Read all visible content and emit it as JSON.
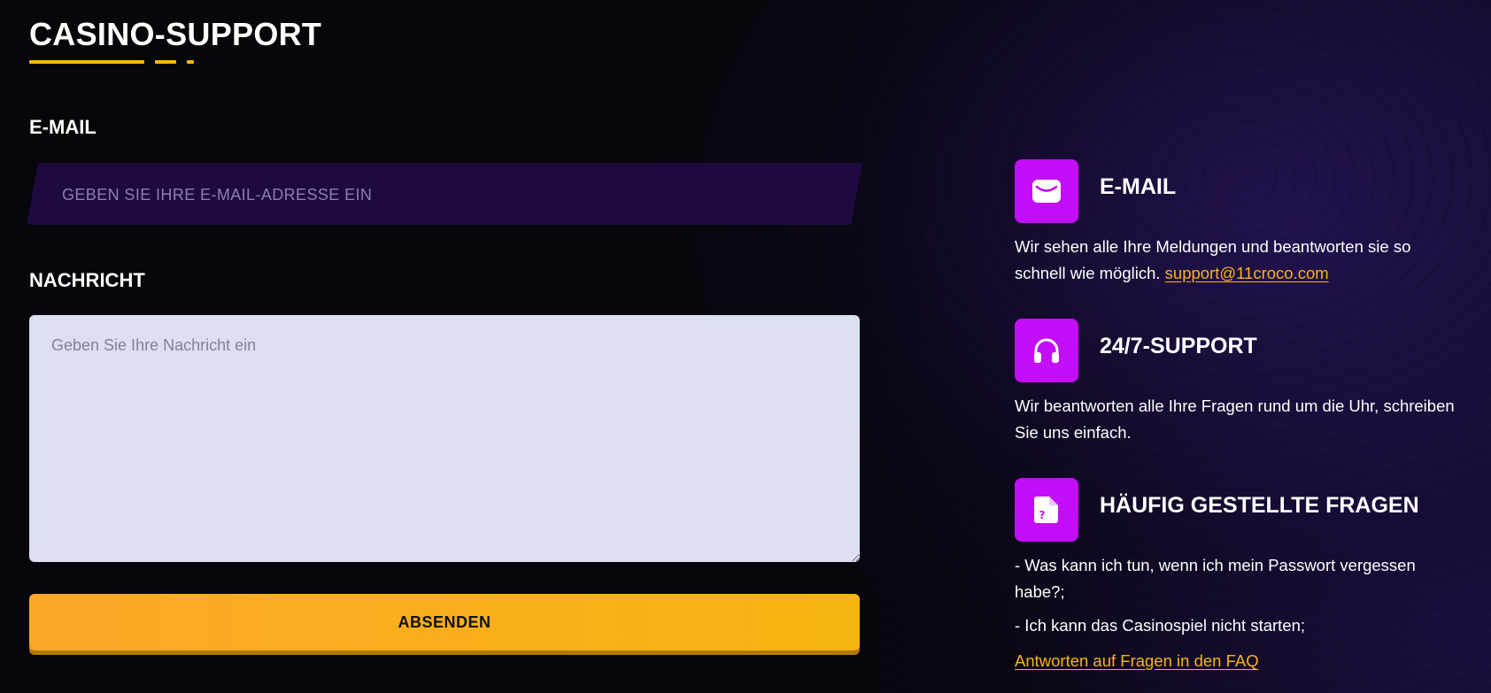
{
  "page": {
    "title": "CASINO-SUPPORT"
  },
  "form": {
    "email_label": "E-MAIL",
    "email_placeholder": "GEBEN SIE IHRE E-MAIL-ADRESSE EIN",
    "message_label": "NACHRICHT",
    "message_placeholder": "Geben Sie Ihre Nachricht ein",
    "submit_label": "ABSENDEN"
  },
  "info": {
    "email": {
      "icon": "envelope-icon",
      "title": "E-MAIL",
      "text": "Wir sehen alle Ihre Meldungen und beantworten sie so schnell wie möglich.",
      "link": "support@11croco.com"
    },
    "support": {
      "icon": "headphones-icon",
      "title": "24/7-SUPPORT",
      "text": "Wir beantworten alle Ihre Fragen rund um die Uhr, schreiben Sie uns einfach."
    },
    "faq": {
      "icon": "question-document-icon",
      "title": "HÄUFIG GESTELLTE FRAGEN",
      "items": [
        "- Was kann ich tun, wenn ich mein Passwort vergessen habe?;",
        "- Ich kann das Casinospiel nicht starten;"
      ],
      "link": "Antworten auf Fragen in den FAQ"
    }
  },
  "colors": {
    "accent": "#f6b51c",
    "icon_bg": "#c40df8",
    "input_bg": "#1e0a3e",
    "textarea_bg": "#dbdff0",
    "page_bg": "#07060b"
  }
}
